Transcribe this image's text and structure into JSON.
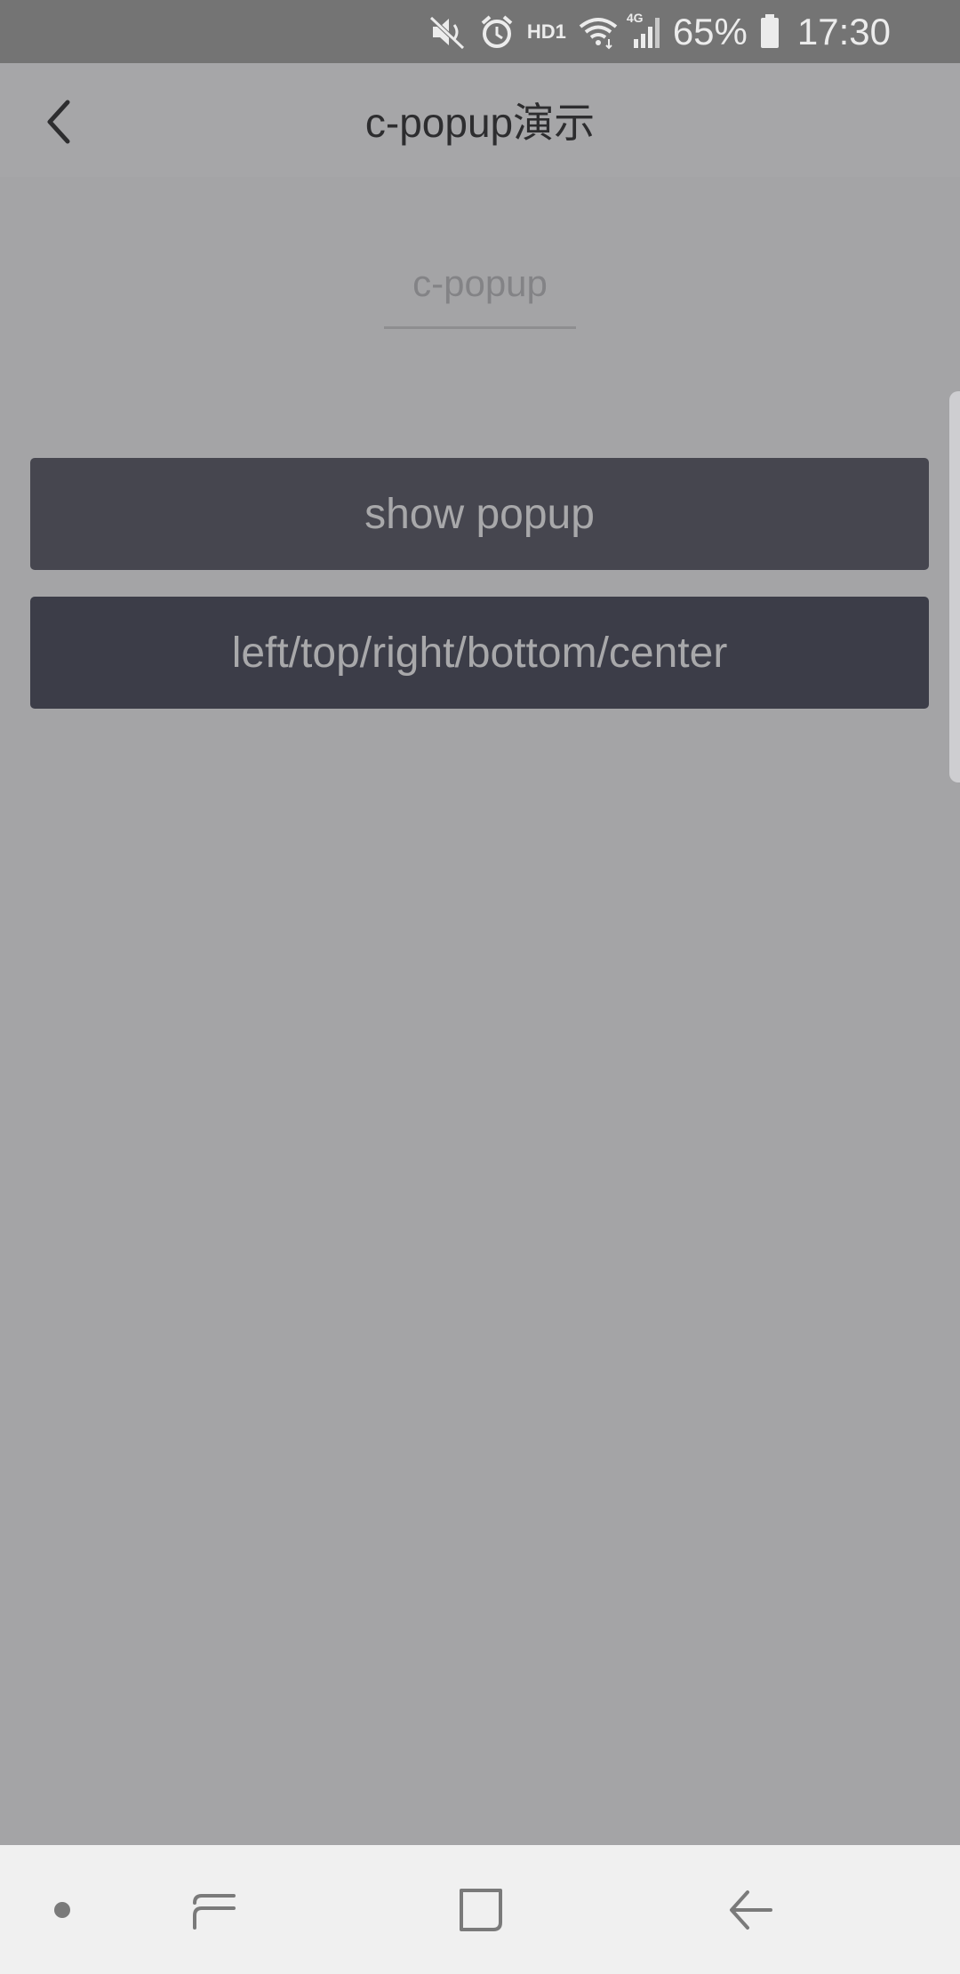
{
  "status_bar": {
    "hd_label": "HD1",
    "network_label": "4G",
    "battery_percent": "65%",
    "time": "17:30",
    "icons": [
      "mute-icon",
      "alarm-icon",
      "hd-icon",
      "wifi-icon",
      "signal-icon",
      "battery-icon"
    ]
  },
  "header": {
    "title": "c-popup演示",
    "back_icon": "chevron-left-icon"
  },
  "content": {
    "subtitle": "c-popup",
    "buttons": [
      {
        "label": "show popup"
      },
      {
        "label": "left/top/right/bottom/center"
      }
    ]
  },
  "nav_bar": {
    "items": [
      "dot-icon",
      "recents-icon",
      "home-icon",
      "back-icon"
    ]
  },
  "colors": {
    "background": "#a4a4a6",
    "status_bar": "#747474",
    "button_primary": "#46464f",
    "button_secondary": "#3c3d48",
    "nav_bar": "#f0f0f0"
  }
}
